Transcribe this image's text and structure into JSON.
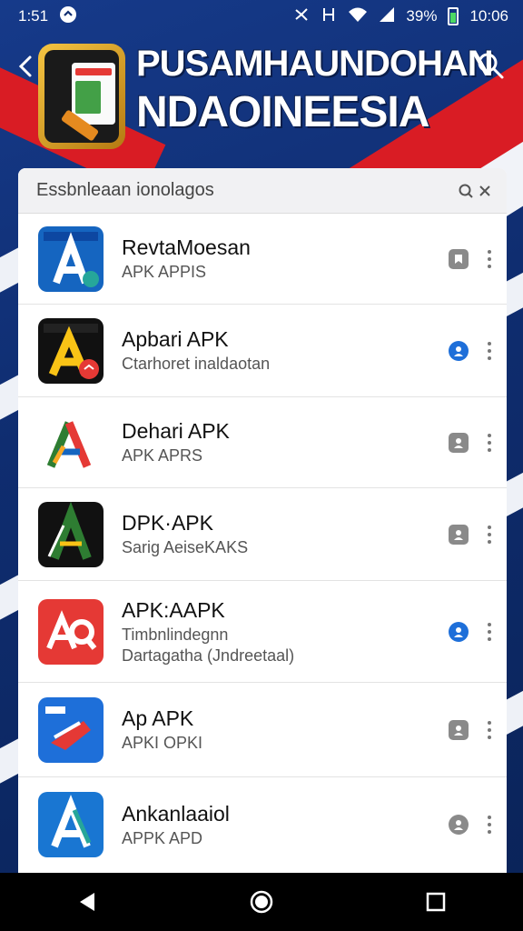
{
  "status_bar": {
    "time": "1:51",
    "battery_percent": "39%",
    "clock": "10:06"
  },
  "header": {
    "title_line1": "PUSAMHAUNDOHAN",
    "title_line2": "NDAOINEESIA"
  },
  "search": {
    "text": "Essbnleaan ionolagos"
  },
  "apps": [
    {
      "title": "RevtaMoesan",
      "subtitle": "APK APPIS",
      "subtitle2": "",
      "badge": "grey",
      "icon": "blue-a"
    },
    {
      "title": "Apbari APK",
      "subtitle": "Ctarhoret inaldaotan",
      "subtitle2": "",
      "badge": "blue",
      "icon": "black-yellow-a"
    },
    {
      "title": "Dehari APK",
      "subtitle": "APK APRS",
      "subtitle2": "",
      "badge": "grey",
      "icon": "white-multicolor-a"
    },
    {
      "title": "DPK·APK",
      "subtitle": "Sarig AeiseKAKS",
      "subtitle2": "",
      "badge": "grey",
      "icon": "black-green-a"
    },
    {
      "title": "APK:AAPK",
      "subtitle": "Timbnlindegnn",
      "subtitle2": "Dartagatha (Jndreetaal)",
      "badge": "blue",
      "icon": "red-aq"
    },
    {
      "title": "Ap APK",
      "subtitle": "APKI OPKI",
      "subtitle2": "",
      "badge": "grey",
      "icon": "blue-red-flag"
    },
    {
      "title": "Ankanlaaiol",
      "subtitle": "APPK APD",
      "subtitle2": "",
      "badge": "grey",
      "icon": "blue-a-2"
    }
  ],
  "colors": {
    "accent_blue": "#1e6fd9",
    "badge_grey": "#8a8a8a",
    "brand_red": "#d91c24",
    "brand_navy": "#0f2d70"
  }
}
